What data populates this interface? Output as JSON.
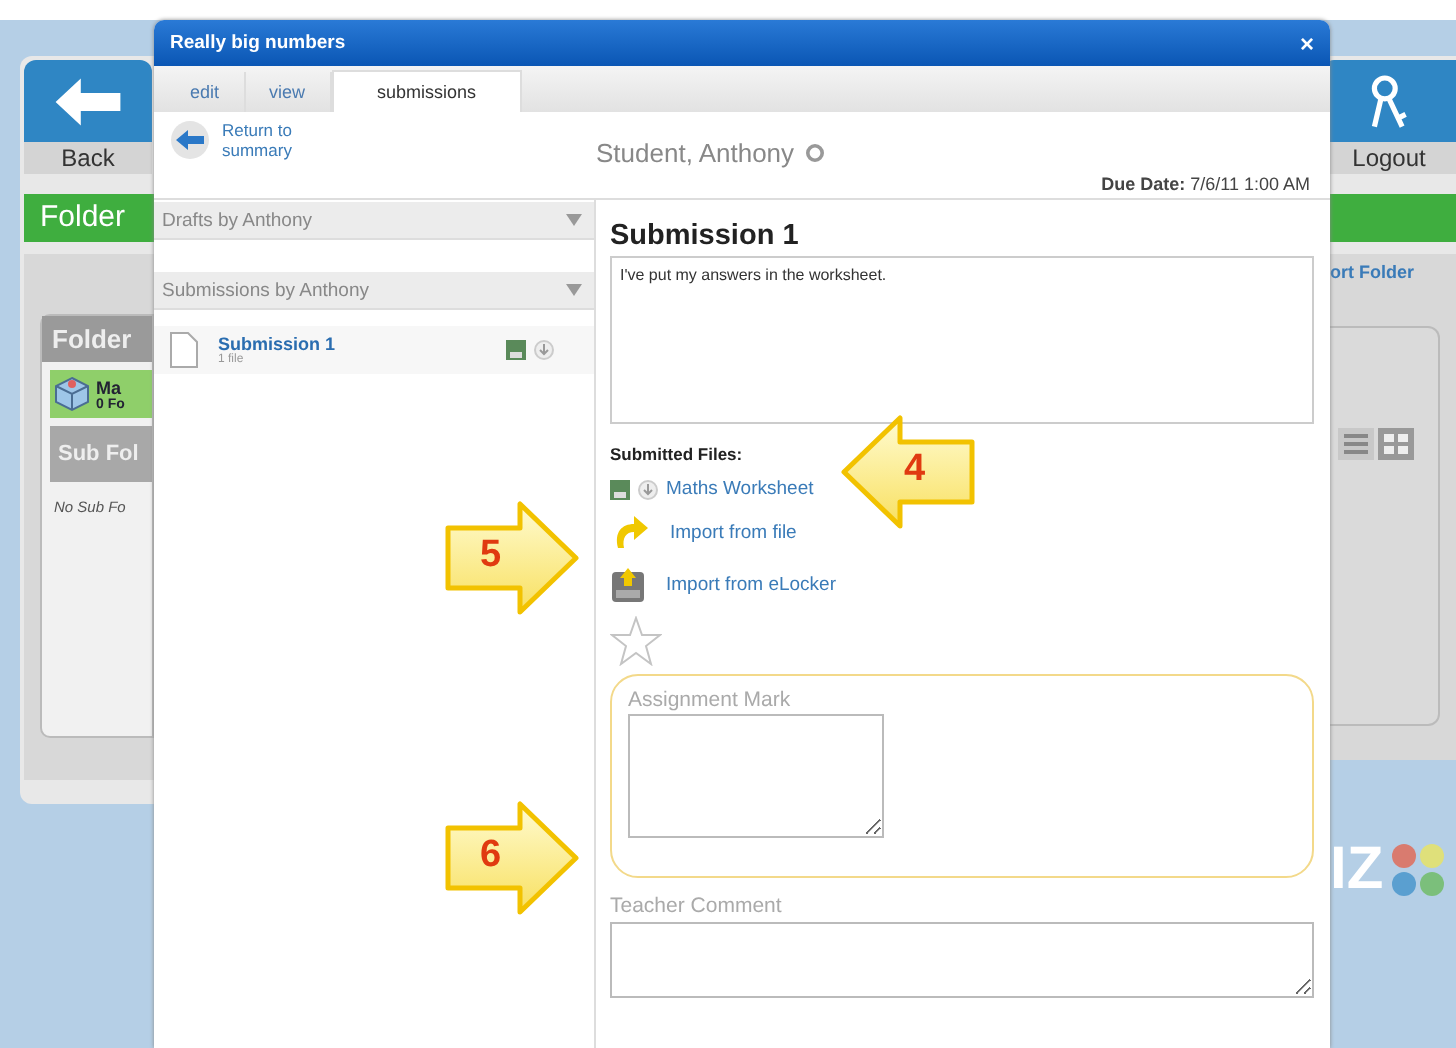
{
  "background": {
    "back_button": "Back",
    "logout_button": "Logout",
    "folder_header": "Folder",
    "folder_card_title": "Folder",
    "folder_item": {
      "name": "Ma",
      "count": "0 Fo"
    },
    "subfolder_header": "Sub Fol",
    "subfolder_empty": "No Sub Fo",
    "folder_action": "ort Folder",
    "logo_text": "IZ"
  },
  "window": {
    "title": "Really big numbers",
    "close": "×"
  },
  "tabs": [
    {
      "label": "edit",
      "selected": false
    },
    {
      "label": "view",
      "selected": false
    },
    {
      "label": "submissions",
      "selected": true
    }
  ],
  "return_link": "Return to summary",
  "student": "Student, Anthony",
  "due_date": "**Due Date:** 7/6/11 1:00 AM",
  "dropdowns": [
    "Drafts by Anthony",
    "Submissions by Anthony"
  ],
  "submissions": [
    {
      "title": "Submission 1",
      "subtitle": "1 file"
    }
  ],
  "detail": {
    "title": "Submission 1",
    "comment": "I've put my answers in the worksheet.",
    "files_label": "Submitted Files:",
    "files": [
      {
        "name": "Maths Worksheet"
      }
    ],
    "actions": [
      {
        "kind": "file",
        "label": "Import from file"
      },
      {
        "kind": "elocker",
        "label": "Import from eLocker"
      }
    ],
    "starred": false,
    "mark_label": "Assignment Mark",
    "comment_label": "Teacher Comment"
  },
  "callouts": [
    {
      "number": "4",
      "kind": "left"
    },
    {
      "number": "5",
      "kind": "right"
    },
    {
      "number": "6",
      "kind": "right"
    }
  ]
}
